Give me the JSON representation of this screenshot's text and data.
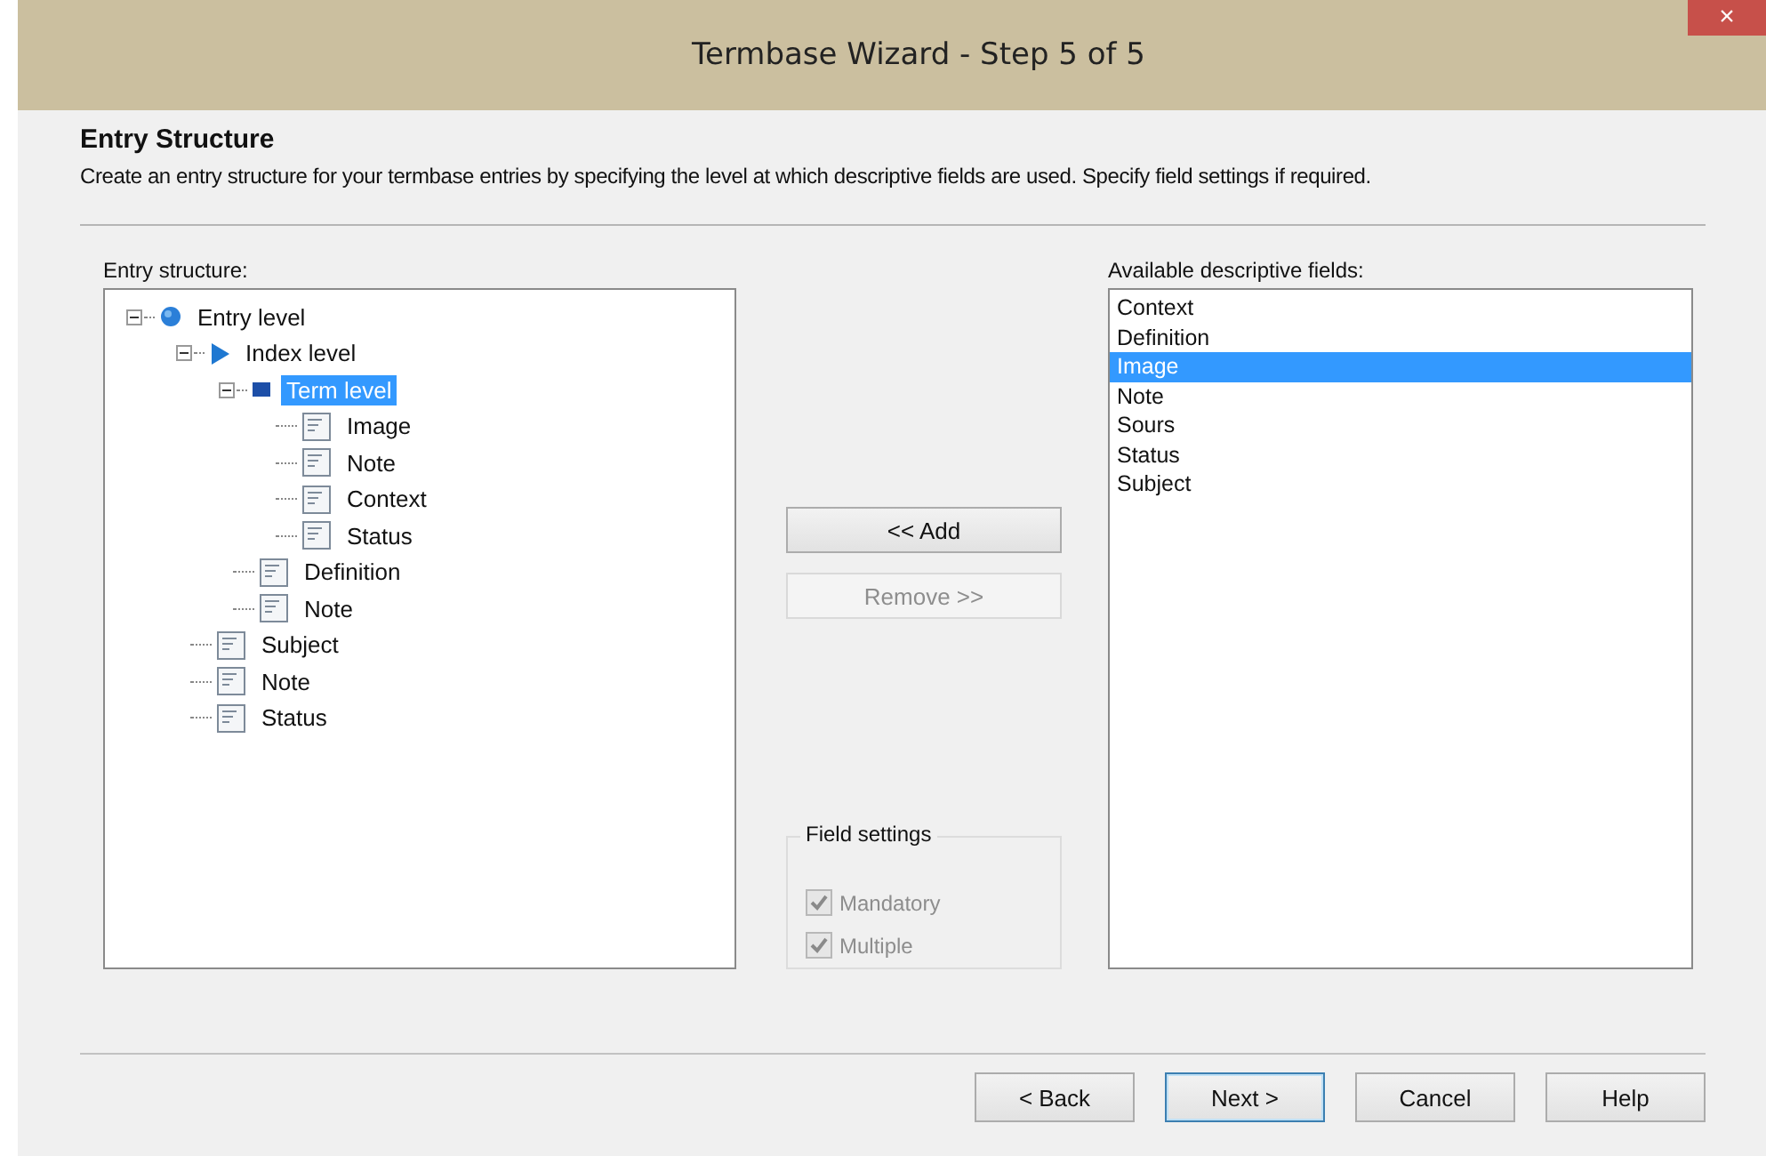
{
  "window": {
    "title": "Termbase Wizard - Step 5 of 5",
    "close": "×"
  },
  "header": {
    "title": "Entry Structure",
    "description": "Create an entry structure for your termbase entries by specifying the level at which descriptive fields are used. Specify field settings if required."
  },
  "entry_structure": {
    "label": "Entry structure:",
    "tree": [
      {
        "label": "Entry level",
        "kind": "entry",
        "expanded": true,
        "selected": false,
        "children": [
          {
            "label": "Index level",
            "kind": "index",
            "expanded": true,
            "selected": false,
            "children": [
              {
                "label": "Term level",
                "kind": "term",
                "expanded": true,
                "selected": true,
                "children": [
                  {
                    "label": "Image",
                    "kind": "field",
                    "selected": false
                  },
                  {
                    "label": "Note",
                    "kind": "field",
                    "selected": false
                  },
                  {
                    "label": "Context",
                    "kind": "field",
                    "selected": false
                  },
                  {
                    "label": "Status",
                    "kind": "field",
                    "selected": false
                  }
                ]
              },
              {
                "label": "Definition",
                "kind": "field",
                "selected": false
              },
              {
                "label": "Note",
                "kind": "field",
                "selected": false
              }
            ]
          },
          {
            "label": "Subject",
            "kind": "field",
            "selected": false
          },
          {
            "label": "Note",
            "kind": "field",
            "selected": false
          },
          {
            "label": "Status",
            "kind": "field",
            "selected": false
          }
        ]
      }
    ]
  },
  "actions": [
    {
      "label": "<< Add",
      "disabled": false
    },
    {
      "label": "Remove >>",
      "disabled": true
    }
  ],
  "field_settings": {
    "title": "Field settings",
    "options": [
      {
        "label": "Mandatory",
        "checked": true,
        "disabled": true
      },
      {
        "label": "Multiple",
        "checked": true,
        "disabled": true
      }
    ]
  },
  "available_fields": {
    "label": "Available descriptive fields:",
    "items": [
      {
        "label": "Context",
        "selected": false
      },
      {
        "label": "Definition",
        "selected": false
      },
      {
        "label": "Image",
        "selected": true
      },
      {
        "label": "Note",
        "selected": false
      },
      {
        "label": "Sours",
        "selected": false
      },
      {
        "label": "Status",
        "selected": false
      },
      {
        "label": "Subject",
        "selected": false
      }
    ]
  },
  "buttons": [
    {
      "label": "< Back",
      "default": false
    },
    {
      "label": "Next >",
      "default": true
    },
    {
      "label": "Cancel",
      "default": false
    },
    {
      "label": "Help",
      "default": false
    }
  ]
}
